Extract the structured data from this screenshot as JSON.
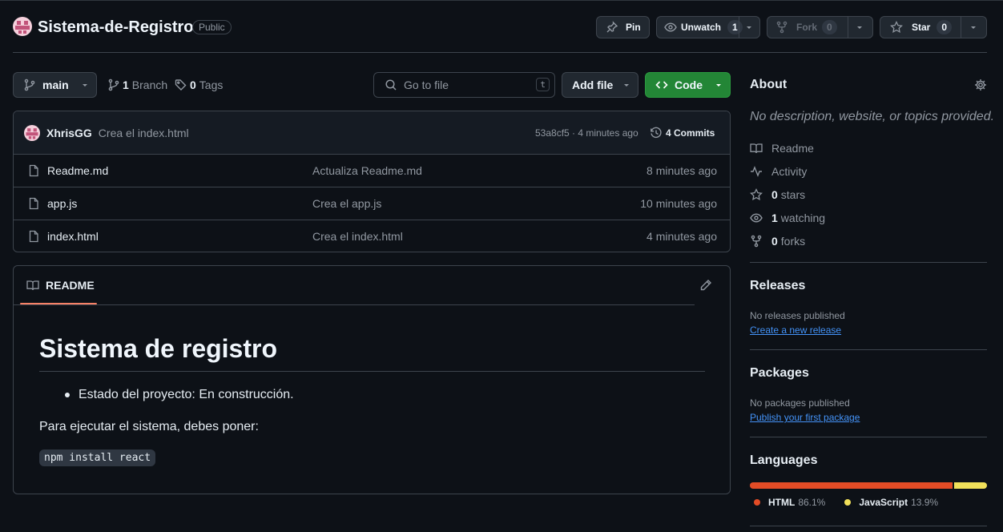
{
  "repo": {
    "name": "Sistema-de-Registro",
    "visibility": "Public"
  },
  "actions": {
    "pin": "Pin",
    "unwatch": "Unwatch",
    "watch_count": "1",
    "fork": "Fork",
    "fork_count": "0",
    "star": "Star",
    "star_count": "0"
  },
  "toolbar": {
    "branch": "main",
    "branches_count": "1",
    "branches_label": "Branch",
    "tags_count": "0",
    "tags_label": "Tags",
    "search_placeholder": "Go to file",
    "search_shortcut": "t",
    "add_file": "Add file",
    "code": "Code"
  },
  "commit": {
    "author": "XhrisGG",
    "message": "Crea el index.html",
    "hash": "53a8cf5",
    "time": "· 4 minutes ago",
    "commits_label": "4 Commits"
  },
  "files": [
    {
      "name": "Readme.md",
      "message": "Actualiza Readme.md",
      "time": "8 minutes ago"
    },
    {
      "name": "app.js",
      "message": "Crea el app.js",
      "time": "10 minutes ago"
    },
    {
      "name": "index.html",
      "message": "Crea el index.html",
      "time": "4 minutes ago"
    }
  ],
  "readme": {
    "tab": "README",
    "title": "Sistema de registro",
    "bullet": "Estado del proyecto: En construcción.",
    "paragraph": "Para ejecutar el sistema, debes poner:",
    "code": "npm install react"
  },
  "about": {
    "title": "About",
    "description": "No description, website, or topics provided.",
    "readme": "Readme",
    "activity": "Activity",
    "stars_count": "0",
    "stars_label": "stars",
    "watching_count": "1",
    "watching_label": "watching",
    "forks_count": "0",
    "forks_label": "forks"
  },
  "releases": {
    "title": "Releases",
    "empty": "No releases published",
    "link": "Create a new release"
  },
  "packages": {
    "title": "Packages",
    "empty": "No packages published",
    "link": "Publish your first package"
  },
  "languages": {
    "title": "Languages",
    "items": [
      {
        "name": "HTML",
        "percent": "86.1%",
        "share": 86.1,
        "color": "#e34c26"
      },
      {
        "name": "JavaScript",
        "percent": "13.9%",
        "share": 13.9,
        "color": "#f1e05a"
      }
    ]
  },
  "colors": {
    "accent_green": "#238636",
    "underline_orange": "#f78166",
    "link_blue": "#4493f8"
  }
}
